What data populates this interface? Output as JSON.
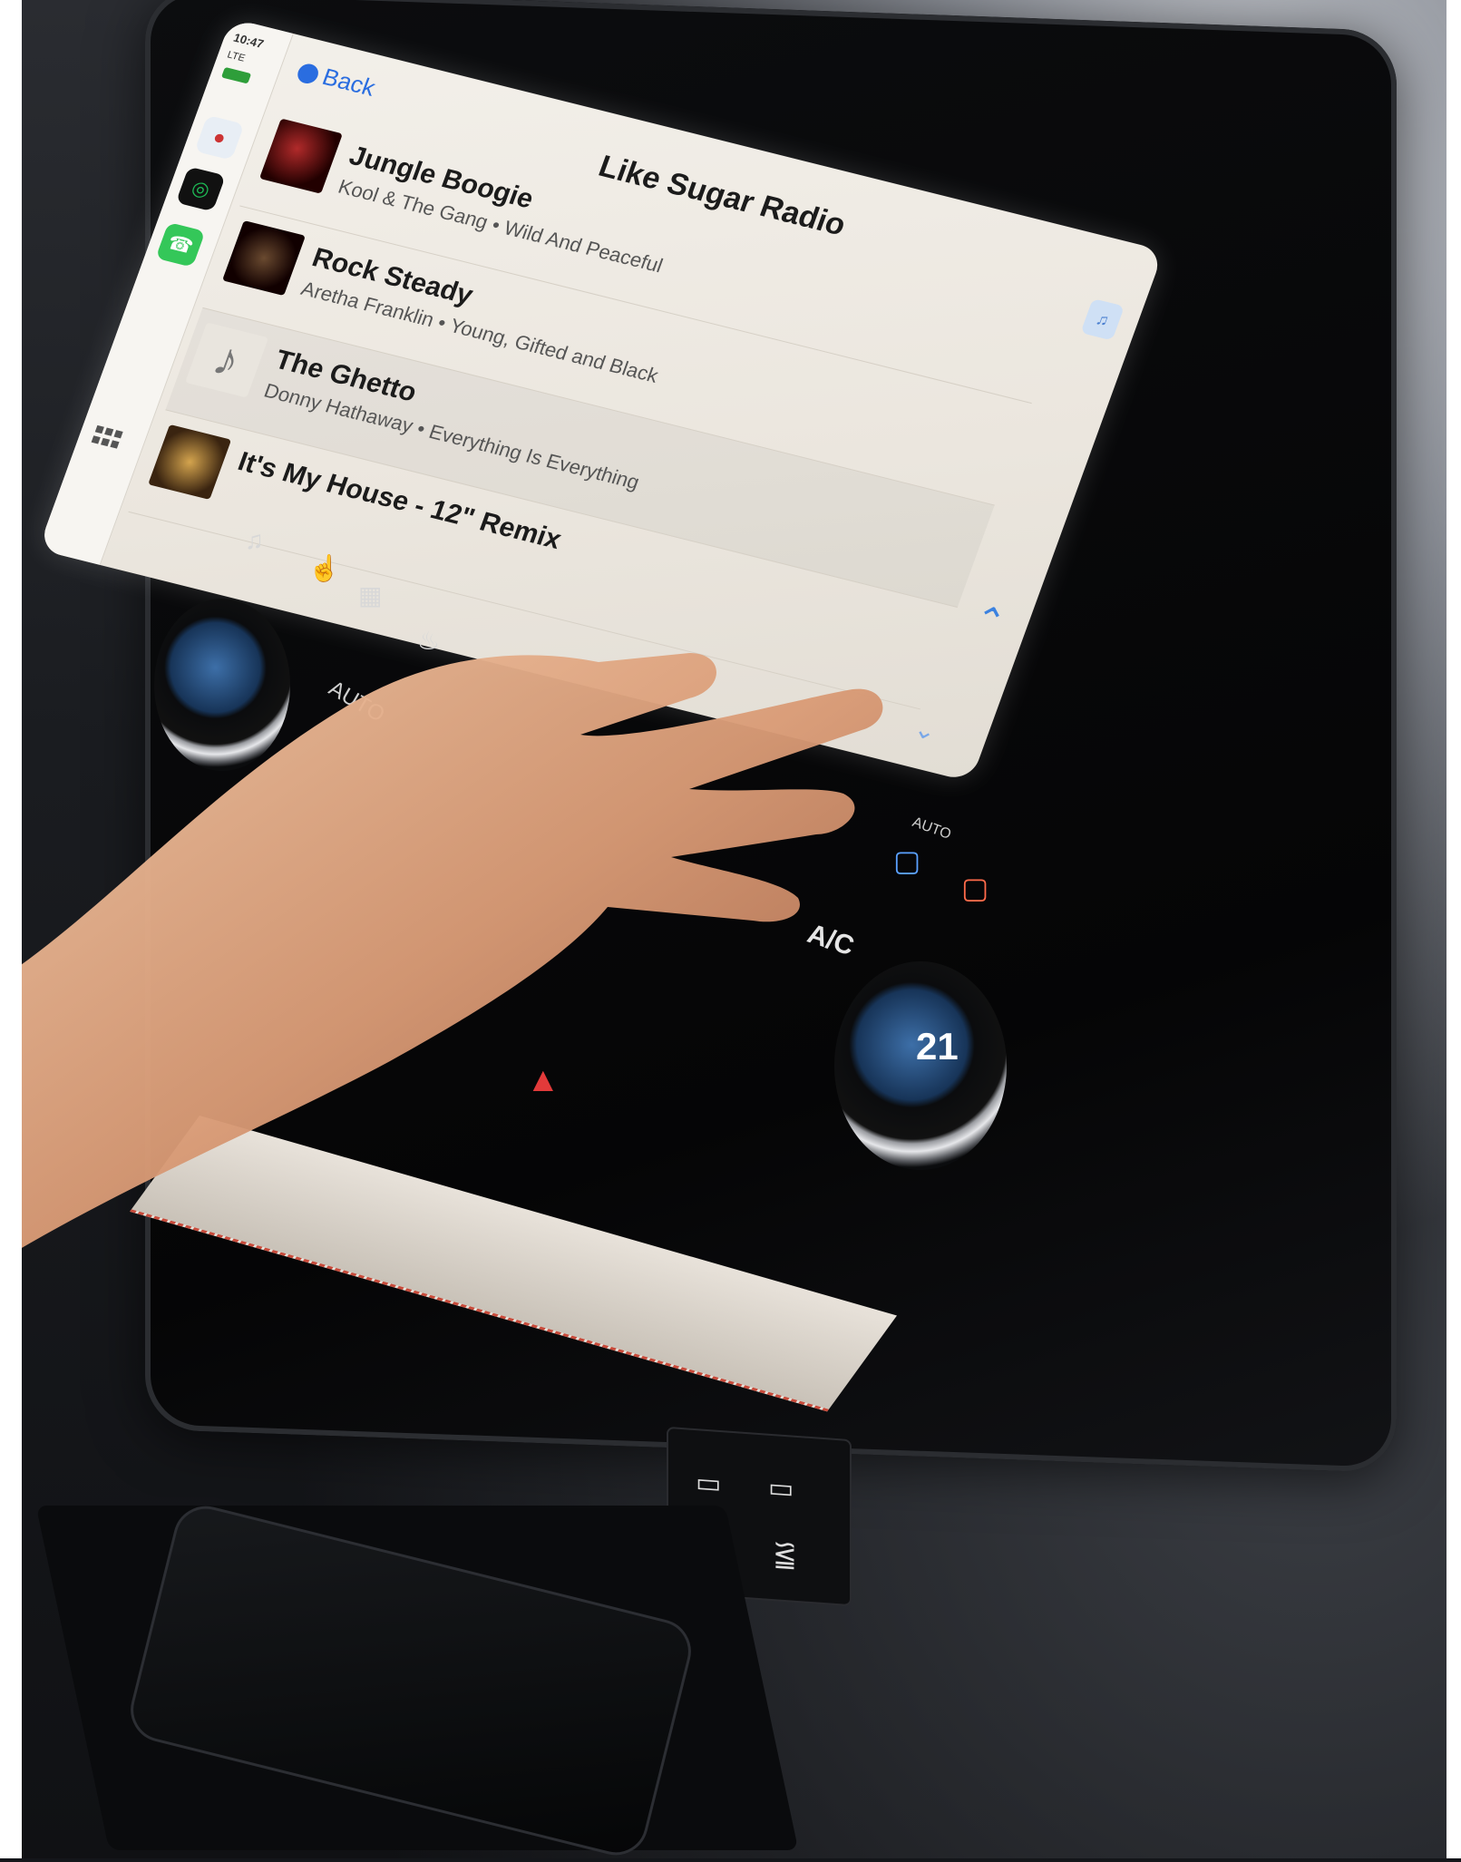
{
  "carplay": {
    "status": {
      "time": "10:47",
      "network": "LTE"
    },
    "back_label": "Back",
    "title": "Like Sugar Radio",
    "tracks": [
      {
        "song": "Jungle Boogie",
        "artist_album": "Kool & The Gang • Wild And Peaceful"
      },
      {
        "song": "Rock Steady",
        "artist_album": "Aretha Franklin • Young, Gifted and Black"
      },
      {
        "song": "The Ghetto",
        "artist_album": "Donny Hathaway • Everything Is Everything"
      },
      {
        "song": "It's My House - 12\" Remix",
        "artist_album": ""
      }
    ]
  },
  "climate": {
    "ac_label": "A/C",
    "auto_label_left": "AUTO",
    "auto_label_right": "AUTO",
    "temperature": "21"
  },
  "colors": {
    "accent_blue": "#2a6de0",
    "phone_green": "#34c759",
    "hazard_red": "#e23a3a",
    "led_orange": "#ff8a2a"
  },
  "icons": [
    "maps-icon",
    "spotify-icon",
    "phone-icon",
    "app-grid-icon",
    "siri-icon",
    "music-note-icon",
    "hazard-icon",
    "usb-c-icon",
    "usb-a-icon",
    "seat-heater-icon"
  ]
}
